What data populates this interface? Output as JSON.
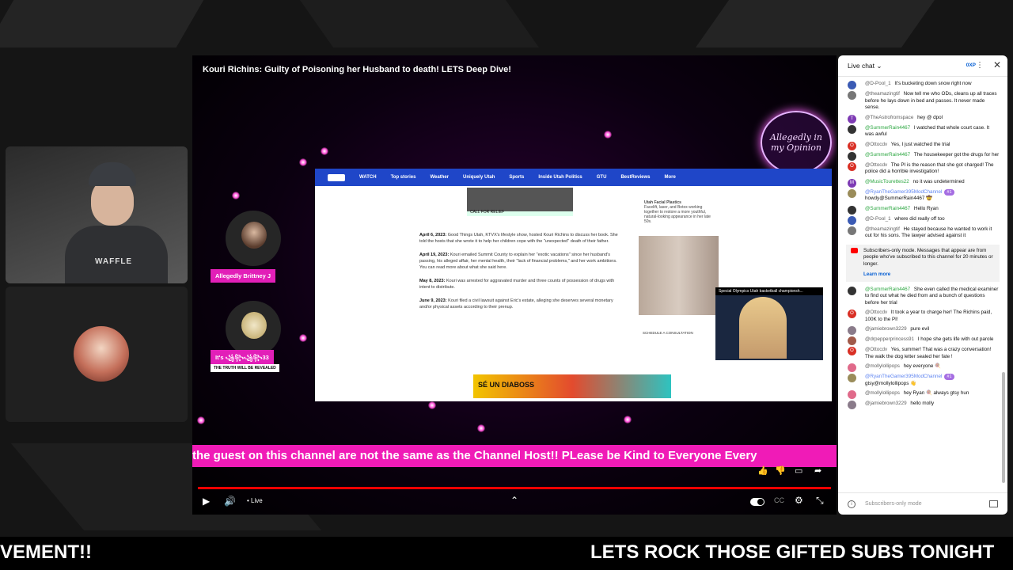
{
  "stream": {
    "title": "Kouri Richins: Guilty of Poisoning her Husband to death!  LETS Deep Dive!",
    "logo_text": "Allegedly in my Opinion",
    "ticker": "the guest on this channel are not the same as the Channel Host!! PLease be Kind to Everyone Every",
    "live_label": "• Live",
    "bottom_crawl_left": "VEMENT!!",
    "bottom_crawl_right": "LETS ROCK THOSE GIFTED SUBS TONIGHT"
  },
  "guests": {
    "guest1_name": "Allegedly Brittney J",
    "guest2_name": "It's ꧁꧂꧁꧂33",
    "guest2_sub": "THE TRUTH WILL BE REVEALED"
  },
  "capture": {
    "nav": [
      "WATCH",
      "Top stories",
      "Weather",
      "Uniquely Utah",
      "Sports",
      "Inside Utah Politics",
      "GTU",
      "BestReviews",
      "More"
    ],
    "article": [
      {
        "date": "April 6, 2023:",
        "text": "Good Things Utah, KTVX's lifestyle show, hosted Kouri Richins to discuss her book. She told the hosts that she wrote it to help her children cope with the \"unexpected\" death of their father."
      },
      {
        "date": "April 19, 2023:",
        "text": "Kouri emailed Summit County to explain her \"exotic vacations\" since her husband's passing, his alleged affair, her mental health, their \"lack of financial problems,\" and her work ambitions. You can read more about what she said here."
      },
      {
        "date": "May 8, 2023:",
        "text": "Kouri was arrested for aggravated murder and three counts of possession of drugs with intent to distribute."
      },
      {
        "date": "June 9, 2023:",
        "text": "Kouri filed a civil lawsuit against Eric's estate, alleging she deserves several monetary and/or physical assets according to their prenup."
      }
    ],
    "side_title": "Utah Facial Plastics",
    "side_text": "Facelift, laser, and Botox working together to restore a more youthful, natural-looking appearance in her late 50s.",
    "pip_title": "Special Olympics Utah basketball championsh...",
    "side_link": "SCHEDULE A CONSULTATION",
    "banner_text": "SÉ UN DIABOSS",
    "mini_ad_label": "CALL FOR RELIEF"
  },
  "chat": {
    "header_title": "Live chat",
    "xp": "0XP",
    "notice_text": "Subscribers-only mode. Messages that appear are from people who've subscribed to this channel for 20 minutes or longer.",
    "notice_link": "Learn more",
    "footer_placeholder": "Subscribers-only mode",
    "messages_before": [
      {
        "author": "@D-Pool_1",
        "role": "",
        "color": "#3b5bb4",
        "text": "It's bucketing down snow right now"
      },
      {
        "author": "@theamazingtif",
        "role": "",
        "color": "#777777",
        "text": "Now tell me who ODs, cleans up all traces before he lays down in bed and passes. It never made sense."
      },
      {
        "author": "@TheAstrofromspace",
        "role": "",
        "color": "#7e3bb4",
        "text": "hey @ dpol",
        "initial": "T"
      },
      {
        "author": "@SummerRain4467",
        "role": "mod",
        "color": "#333333",
        "text": "I watched that whole court case. It was awful"
      },
      {
        "author": "@Ottocdv",
        "role": "",
        "color": "#d93025",
        "text": "Yes, I just watched the trial",
        "initial": "O"
      },
      {
        "author": "@SummerRain4467",
        "role": "mod",
        "color": "#333333",
        "text": "The housekeeper got the drugs for her"
      },
      {
        "author": "@Ottocdv",
        "role": "",
        "color": "#d93025",
        "text": "The PI is the reason that she got charged! The police did a horrible investigation!",
        "initial": "O"
      },
      {
        "author": "@MusicTourettes22",
        "role": "mod",
        "color": "#7e3bb4",
        "text": "no it was undetermined",
        "initial": "M"
      },
      {
        "author": "@RyanTheGamer395ModChannel",
        "role": "owner",
        "color": "#9a8c5a",
        "text": "howdy@SummerRain4467 🤠",
        "badge": "#1"
      },
      {
        "author": "@SummerRain4467",
        "role": "mod",
        "color": "#333333",
        "text": "Hello Ryan"
      },
      {
        "author": "@D-Pool_1",
        "role": "",
        "color": "#3b5bb4",
        "text": "where did really off too"
      },
      {
        "author": "@theamazingtif",
        "role": "",
        "color": "#777777",
        "text": "He stayed because he wanted to work it out for his sons. The lawyer advised against it"
      }
    ],
    "messages_after": [
      {
        "author": "@SummerRain4467",
        "role": "mod",
        "color": "#333333",
        "text": "She even called the medical examiner to find out what he died from and a bunch of questions before her trial"
      },
      {
        "author": "@Ottocdv",
        "role": "",
        "color": "#d93025",
        "text": "It took a year to charge her! The Richins paid, 100K to the PI!",
        "initial": "O"
      },
      {
        "author": "@jamiebrown3229",
        "role": "",
        "color": "#8a7b8a",
        "text": "pure evil"
      },
      {
        "author": "@drpepperprincess91",
        "role": "",
        "color": "#a15a4a",
        "text": "I hope she gets life with out parole"
      },
      {
        "author": "@Ottocdv",
        "role": "",
        "color": "#d93025",
        "text": "Yes, summer! That was a crazy conversation! The walk the dog letter sealed her fate !",
        "initial": "O"
      },
      {
        "author": "@mollylollipops",
        "role": "",
        "color": "#e06a8a",
        "text": "hey everyone 🍭"
      },
      {
        "author": "@RyanTheGamer395ModChannel",
        "role": "owner",
        "color": "#9a8c5a",
        "text": "gtsy@mollylollipops 👋",
        "badge": "#1"
      },
      {
        "author": "@mollylollipops",
        "role": "",
        "color": "#e06a8a",
        "text": "hey Ryan 🍭 always gtsy hun"
      },
      {
        "author": "@jamiebrown3229",
        "role": "",
        "color": "#8a7b8a",
        "text": "hello molly"
      }
    ]
  }
}
